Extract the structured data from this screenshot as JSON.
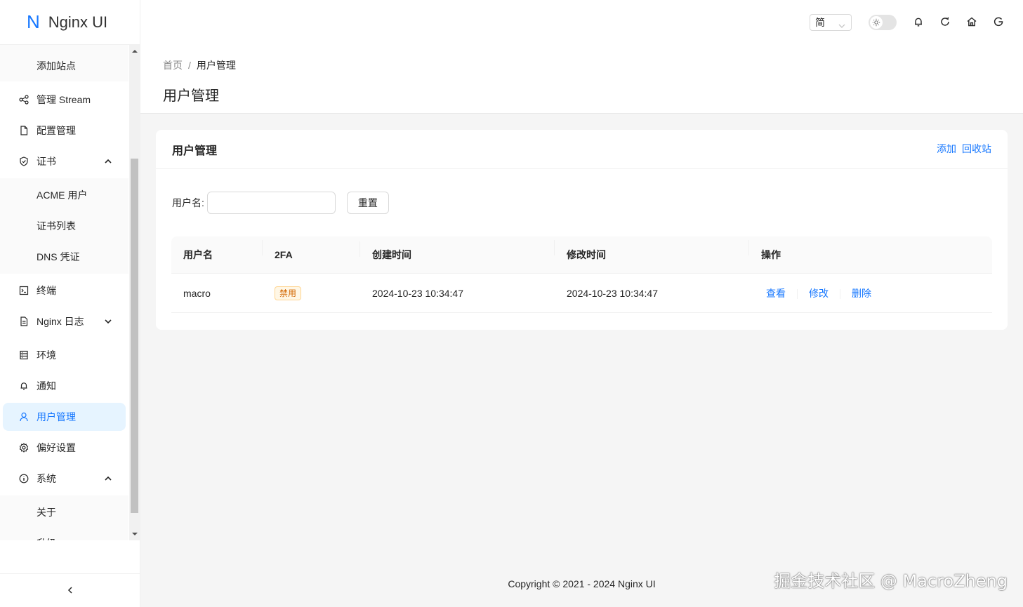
{
  "app": {
    "logo_letter": "N",
    "title": "Nginx UI"
  },
  "sidebar": {
    "items": [
      {
        "label": "添加站点"
      },
      {
        "label": "管理 Stream"
      },
      {
        "label": "配置管理"
      },
      {
        "label": "证书"
      },
      {
        "label": "ACME 用户"
      },
      {
        "label": "证书列表"
      },
      {
        "label": "DNS 凭证"
      },
      {
        "label": "终端"
      },
      {
        "label": "Nginx 日志"
      },
      {
        "label": "环境"
      },
      {
        "label": "通知"
      },
      {
        "label": "用户管理"
      },
      {
        "label": "偏好设置"
      },
      {
        "label": "系统"
      },
      {
        "label": "关于"
      },
      {
        "label": "升级"
      }
    ]
  },
  "header": {
    "lang": "简"
  },
  "breadcrumb": {
    "home": "首页",
    "sep": "/",
    "current": "用户管理"
  },
  "page": {
    "title": "用户管理"
  },
  "card": {
    "title": "用户管理",
    "add": "添加",
    "trash": "回收站",
    "filter_label": "用户名:",
    "filter_value": "",
    "reset": "重置"
  },
  "table": {
    "columns": [
      "用户名",
      "2FA",
      "创建时间",
      "修改时间",
      "操作"
    ],
    "rows": [
      {
        "username": "macro",
        "twofa": "禁用",
        "created": "2024-10-23 10:34:47",
        "modified": "2024-10-23 10:34:47",
        "actions": [
          "查看",
          "修改",
          "删除"
        ]
      }
    ]
  },
  "footer": {
    "copyright": "Copyright © 2021 - 2024 Nginx UI"
  },
  "watermark": "掘金技术社区 @ MacroZheng",
  "colors": {
    "primary": "#1677ff",
    "tag_warning": "#d46b08"
  }
}
